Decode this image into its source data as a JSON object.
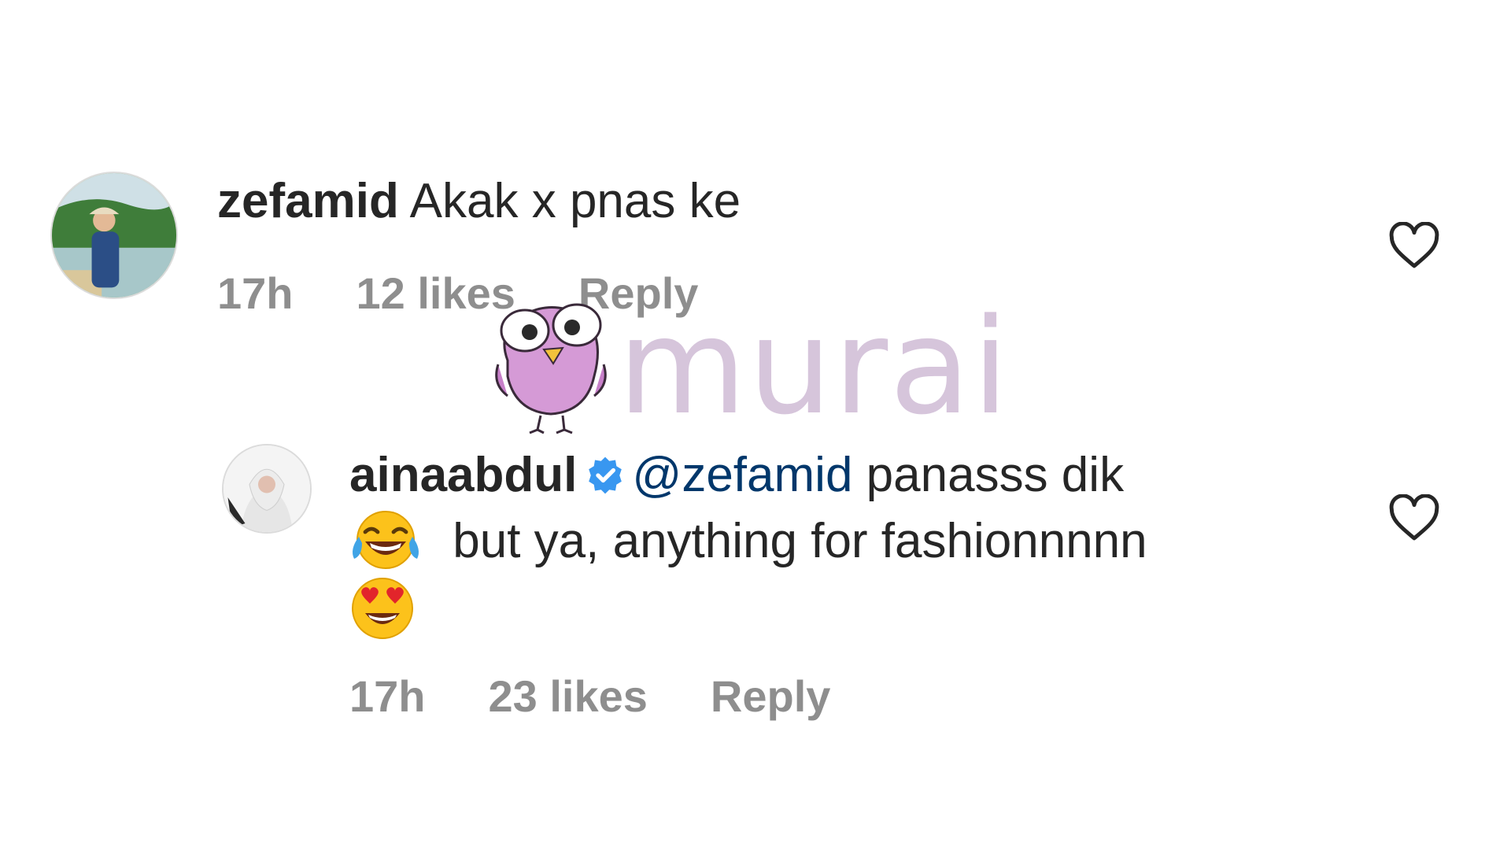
{
  "comments": [
    {
      "username": "zefamid",
      "text": "Akak x pnas ke",
      "time": "17h",
      "likes": "12 likes",
      "reply": "Reply"
    },
    {
      "username": "ainaabdul",
      "verified": true,
      "mention": "@zefamid",
      "text_line1": "panasss dik",
      "emoji1": "face-with-tears-of-joy",
      "text_line2": "but ya, anything for fashionnnnn",
      "emoji2": "smiling-face-with-heart-eyes",
      "time": "17h",
      "likes": "23 likes",
      "reply": "Reply"
    }
  ],
  "watermark": {
    "text": "murai",
    "icon": "owl-icon",
    "color": "#d4c2da"
  },
  "colors": {
    "mention": "#00376b",
    "meta": "#8e8e8e",
    "verified": "#3897f0"
  }
}
